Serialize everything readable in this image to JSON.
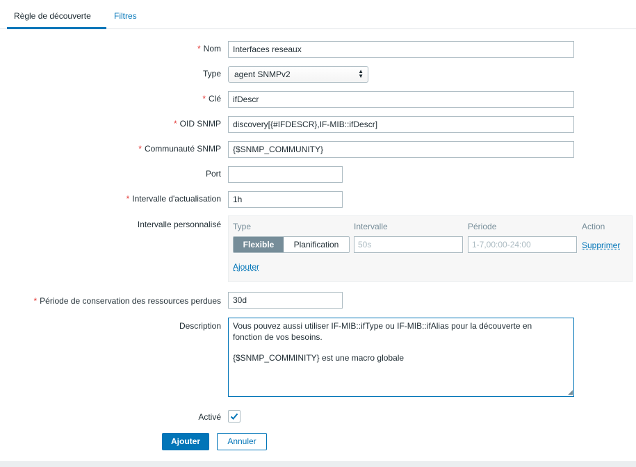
{
  "tabs": [
    {
      "label": "Règle de découverte"
    },
    {
      "label": "Filtres"
    }
  ],
  "form": {
    "required_mark": "*",
    "name": {
      "label": "Nom",
      "value": "Interfaces reseaux"
    },
    "type": {
      "label": "Type",
      "value": "agent SNMPv2"
    },
    "key": {
      "label": "Clé",
      "value": "ifDescr"
    },
    "snmp_oid": {
      "label": "OID SNMP",
      "value": "discovery[{#IFDESCR},IF-MIB::ifDescr]"
    },
    "snmp_community": {
      "label": "Communauté SNMP",
      "value": "{$SNMP_COMMUNITY}"
    },
    "port": {
      "label": "Port",
      "value": ""
    },
    "update_interval": {
      "label": "Intervalle d'actualisation",
      "value": "1h"
    },
    "custom_intervals": {
      "label": "Intervalle personnalisé",
      "headers": {
        "type": "Type",
        "interval": "Intervalle",
        "period": "Période",
        "action": "Action"
      },
      "row": {
        "type_options": [
          "Flexible",
          "Planification"
        ],
        "type_selected": "Flexible",
        "interval_placeholder": "50s",
        "period_placeholder": "1-7,00:00-24:00",
        "remove": "Supprimer"
      },
      "add": "Ajouter"
    },
    "lost_resources_period": {
      "label": "Période de conservation des ressources perdues",
      "value": "30d"
    },
    "description": {
      "label": "Description",
      "line1": "Vous pouvez aussi utiliser IF-MIB::ifType ou IF-MIB::ifAlias pour la découverte en",
      "line2": "fonction de vos besoins.",
      "line3": "{$SNMP_COMMINITY} est une macro globale"
    },
    "enabled": {
      "label": "Activé",
      "checked": true
    }
  },
  "buttons": {
    "add": "Ajouter",
    "cancel": "Annuler"
  },
  "colors": {
    "accent": "#0275b8",
    "required": "#e33734",
    "muted": "#768d99"
  }
}
